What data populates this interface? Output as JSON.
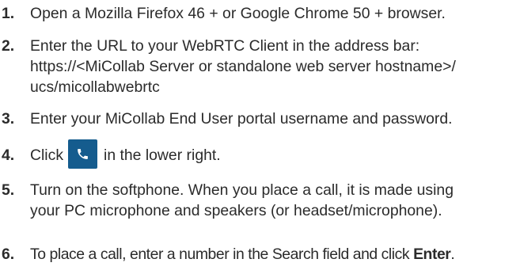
{
  "steps": [
    {
      "number": "1.",
      "lines": [
        "Open a Mozilla Firefox 46 + or Google Chrome 50 + browser."
      ]
    },
    {
      "number": "2.",
      "lines": [
        "Enter the URL to your WebRTC Client in the address bar:",
        "https://<MiCollab Server or standalone web server hostname>/",
        "ucs/micollabwebrtc"
      ]
    },
    {
      "number": "3.",
      "lines": [
        "Enter your MiCollab End User portal username and password."
      ]
    },
    {
      "number": "4.",
      "before_icon": "Click",
      "after_icon": "in the lower right.",
      "icon": "phone-icon",
      "icon_color": "#155c8e"
    },
    {
      "number": "5.",
      "lines": [
        "Turn on the softphone. When you place a call, it is made using",
        "your PC microphone and speakers (or headset/microphone)."
      ]
    },
    {
      "number": "6.",
      "text_before_bold": "To place a call, enter a number in the Search field and click ",
      "bold": "Enter",
      "text_after_bold": "."
    }
  ]
}
